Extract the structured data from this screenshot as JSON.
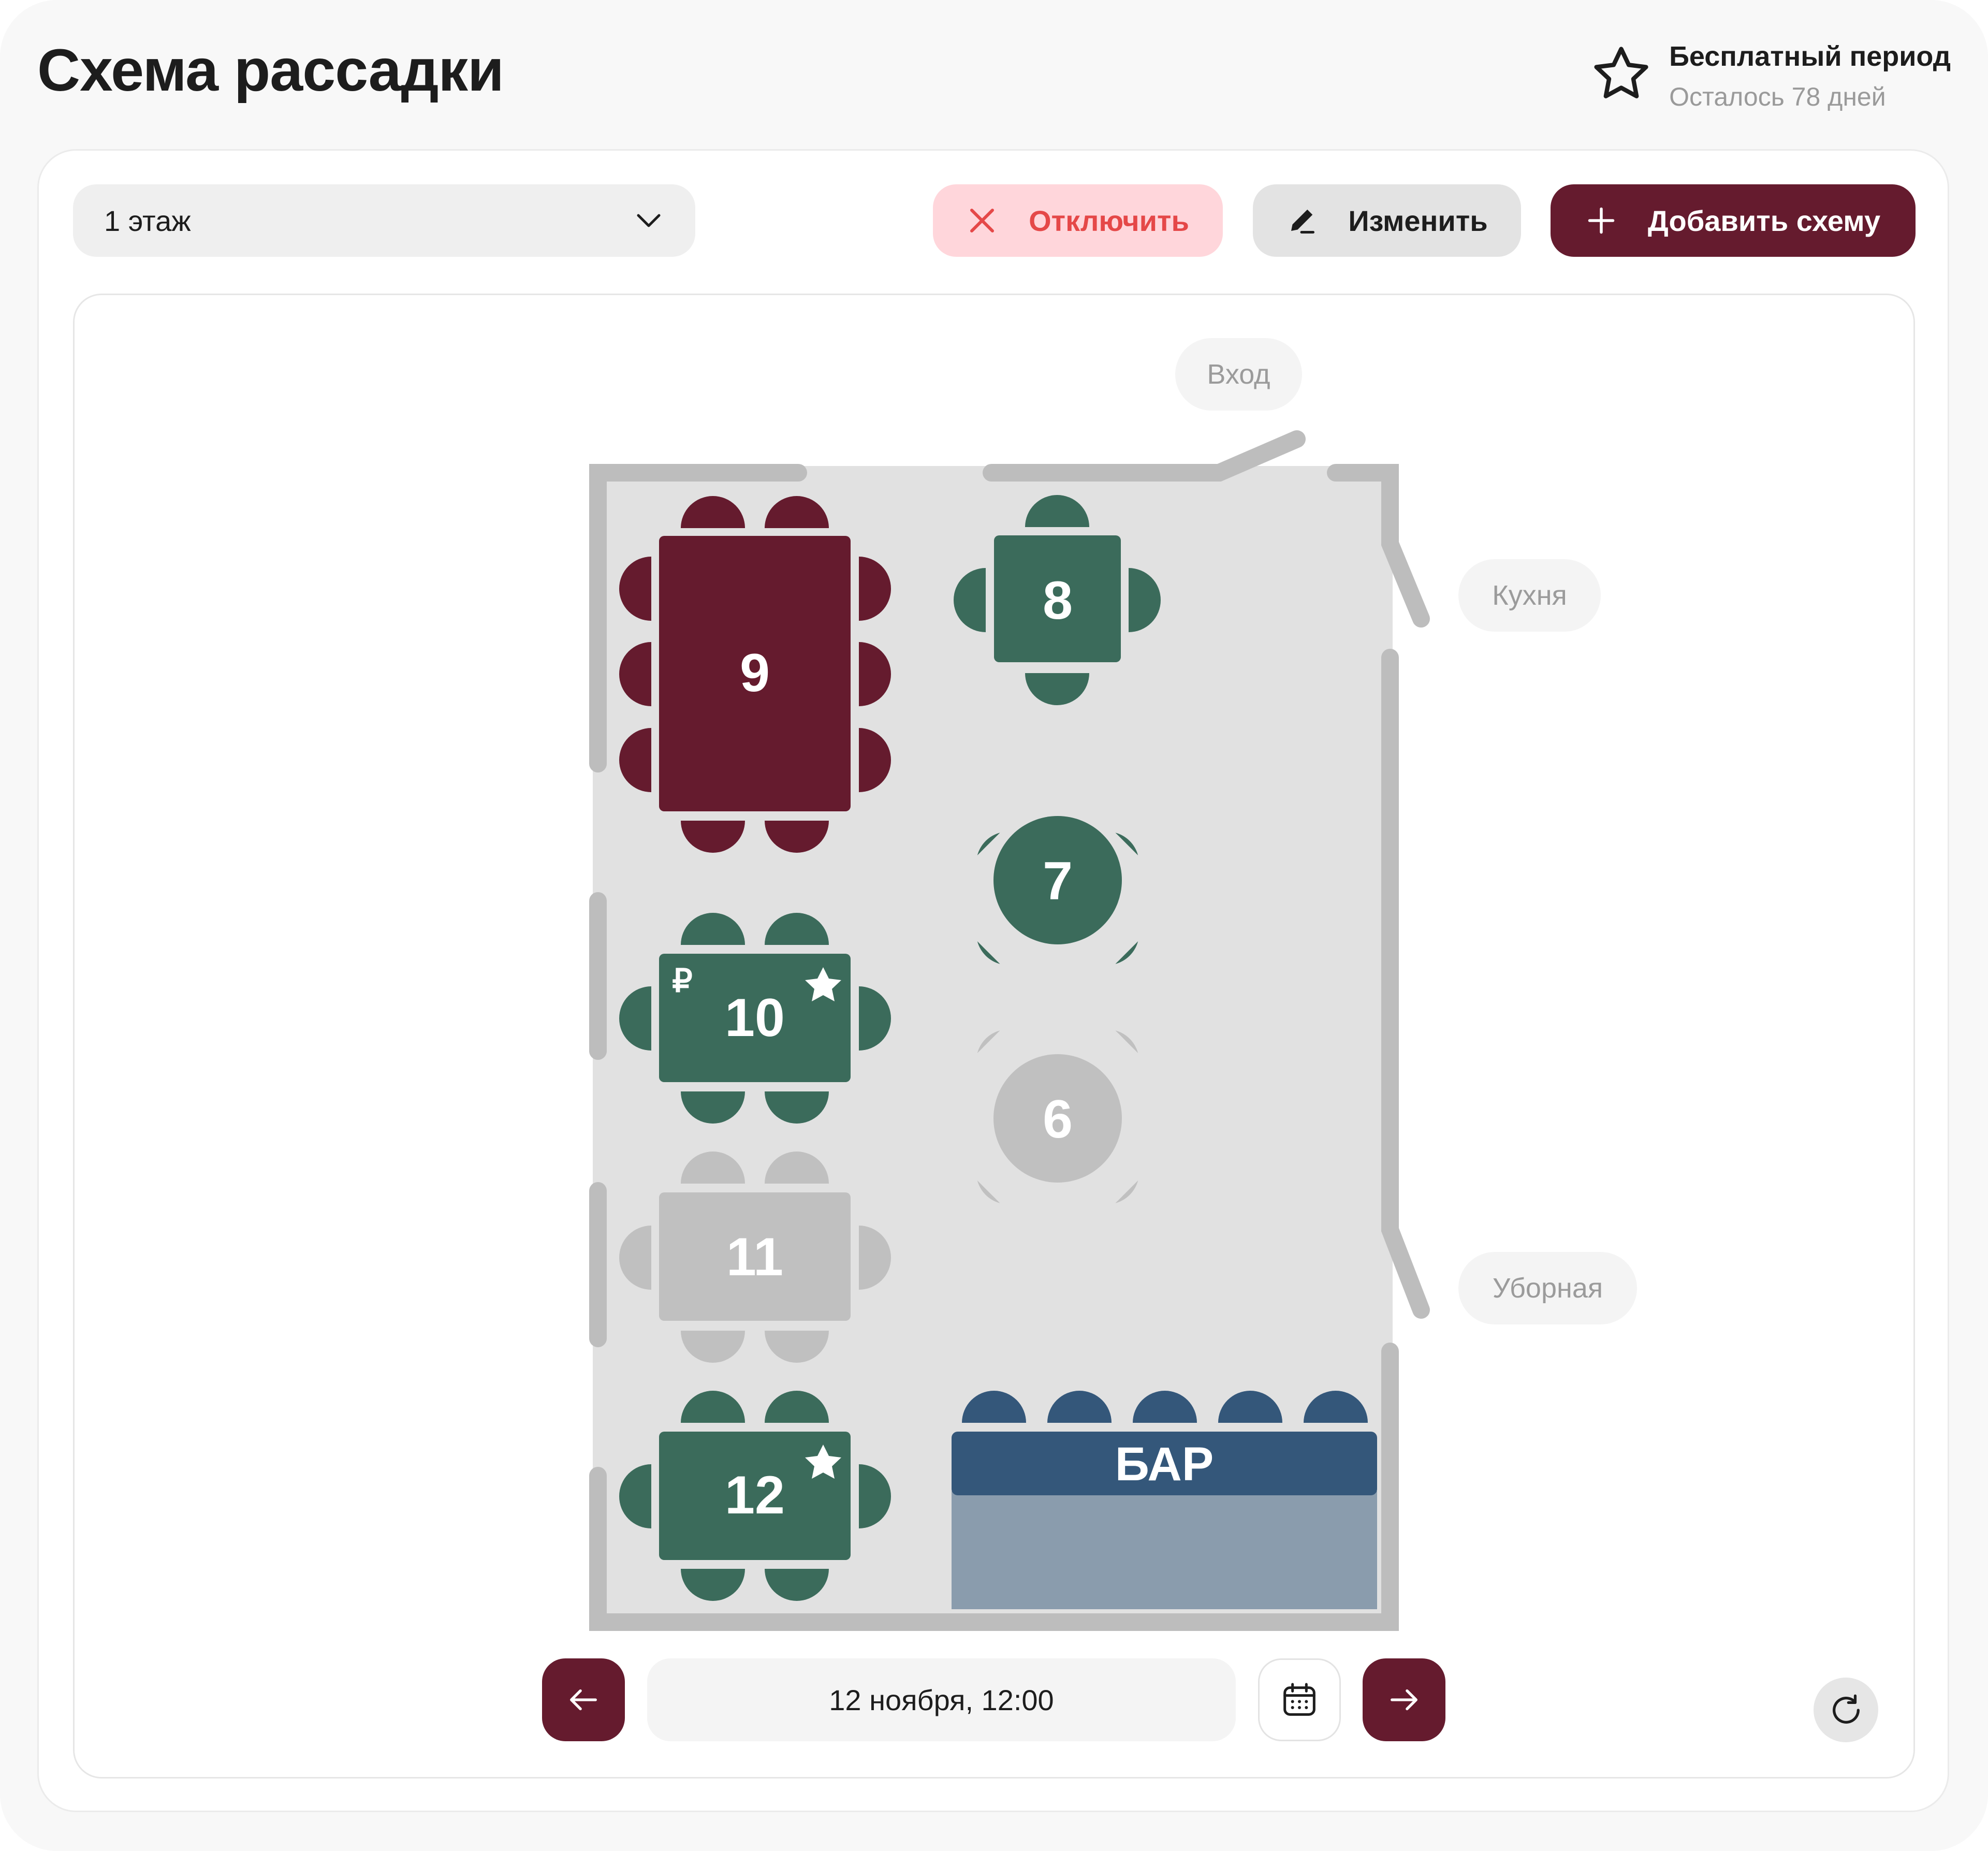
{
  "header": {
    "title": "Схема рассадки",
    "trial_title": "Бесплатный период",
    "trial_subtitle": "Осталось 78 дней"
  },
  "toolbar": {
    "floor_selected": "1 этаж",
    "disable_label": "Отключить",
    "edit_label": "Изменить",
    "add_label": "Добавить схему"
  },
  "plan": {
    "rooms": {
      "entrance": "Вход",
      "kitchen": "Кухня",
      "restroom": "Уборная"
    },
    "bar_label": "БАР",
    "tables": [
      {
        "number": "9",
        "shape": "rect",
        "seats": 10,
        "status": "reserved",
        "color": "#651b2e"
      },
      {
        "number": "8",
        "shape": "square",
        "seats": 4,
        "status": "available",
        "color": "#3b6b5b"
      },
      {
        "number": "7",
        "shape": "round",
        "seats": 4,
        "status": "available",
        "color": "#3b6b5b"
      },
      {
        "number": "10",
        "shape": "rect",
        "seats": 6,
        "status": "available",
        "color": "#3b6b5b",
        "deposit_icon": "₽",
        "vip": true
      },
      {
        "number": "6",
        "shape": "round",
        "seats": 4,
        "status": "disabled",
        "color": "#c0c0c0"
      },
      {
        "number": "11",
        "shape": "rect",
        "seats": 6,
        "status": "disabled",
        "color": "#c0c0c0"
      },
      {
        "number": "12",
        "shape": "rect",
        "seats": 6,
        "status": "available",
        "color": "#3b6b5b",
        "vip": true
      }
    ],
    "bar_seats": 5
  },
  "footer": {
    "datetime": "12 ноября, 12:00",
    "prev_icon": "arrow-left-icon",
    "next_icon": "arrow-right-icon",
    "calendar_icon": "calendar-icon",
    "refresh_icon": "refresh-icon"
  },
  "colors": {
    "brand": "#651b2e",
    "available": "#3b6b5b",
    "disabled": "#c0c0c0",
    "bar": "#34577a",
    "bar_counter": "#8a9cad",
    "danger": "#e54848"
  }
}
